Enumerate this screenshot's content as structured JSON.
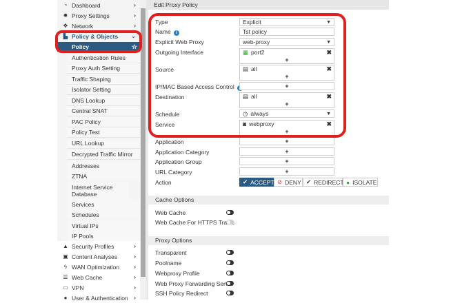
{
  "sidebar": {
    "top": [
      {
        "label": "Dashboard",
        "icon": "dashboard-icon"
      },
      {
        "label": "Proxy Settings",
        "icon": "gear-icon"
      },
      {
        "label": "Network",
        "icon": "network-icon"
      },
      {
        "label": "Policy & Objects",
        "icon": "policy-icon"
      }
    ],
    "sub": [
      "Policy",
      "Authentication Rules",
      "Proxy Auth Setting",
      "Traffic Shaping",
      "Isolator Setting",
      "DNS Lookup",
      "Central SNAT",
      "PAC Policy",
      "Policy Test",
      "URL Lookup",
      "Decrypted Traffic Mirror",
      "Addresses",
      "ZTNA",
      "Internet Service Database",
      "Services",
      "Schedules",
      "Virtual IPs",
      "IP Pools"
    ],
    "bottom": [
      {
        "label": "Security Profiles",
        "icon": "lock-icon"
      },
      {
        "label": "Content Analyses",
        "icon": "content-icon"
      },
      {
        "label": "WAN Optimization",
        "icon": "bolt-icon"
      },
      {
        "label": "Web Cache",
        "icon": "database-icon"
      },
      {
        "label": "VPN",
        "icon": "laptop-icon"
      },
      {
        "label": "User & Authentication",
        "icon": "user-icon"
      }
    ]
  },
  "header": {
    "title": "Edit Proxy Policy"
  },
  "form": {
    "type": {
      "label": "Type",
      "value": "Explicit"
    },
    "name": {
      "label": "Name",
      "value": "Tst policy"
    },
    "explicit_web_proxy": {
      "label": "Explicit Web Proxy",
      "value": "web-proxy"
    },
    "outgoing_interface": {
      "label": "Outgoing Interface",
      "value": "port2"
    },
    "source": {
      "label": "Source",
      "value": "all"
    },
    "ipmac": {
      "label": "IP/MAC Based Access Control"
    },
    "destination": {
      "label": "Destination",
      "value": "all"
    },
    "schedule": {
      "label": "Schedule",
      "value": "always"
    },
    "service": {
      "label": "Service",
      "value": "webproxy"
    },
    "application": {
      "label": "Application"
    },
    "application_category": {
      "label": "Application Category"
    },
    "application_group": {
      "label": "Application Group"
    },
    "url_category": {
      "label": "URL Category"
    },
    "action": {
      "label": "Action",
      "options": [
        "ACCEPT",
        "DENY",
        "REDIRECT",
        "ISOLATE"
      ],
      "selected": "ACCEPT"
    }
  },
  "cache": {
    "title": "Cache Options",
    "items": [
      "Web Cache",
      "Web Cache For HTTPS Traffic"
    ]
  },
  "proxy": {
    "title": "Proxy Options",
    "items": [
      "Transparent",
      "Poolname",
      "Webproxy Profile",
      "Web Proxy Forwarding Server",
      "SSH Policy Redirect"
    ]
  },
  "colors": {
    "accent": "#2d5a80",
    "highlight": "#e0201e"
  }
}
